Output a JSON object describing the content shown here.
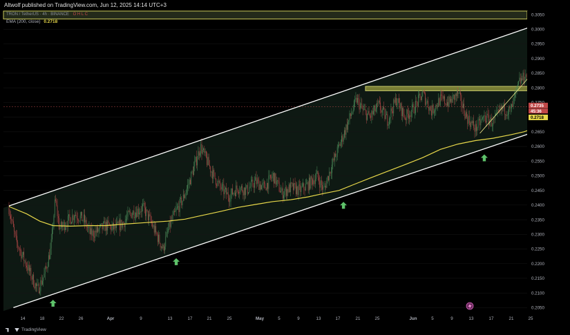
{
  "header": {
    "title": "Altwolf published on TradingView.com, Jun 12, 2025 14:14 UTC+3"
  },
  "legend": {
    "symbol": "TRON / TetherUS · 4h · BINANCE",
    "ohlc": "O  H  L  C",
    "ema_label": "EMA (200, close)",
    "ema_value": "0.2718"
  },
  "footer": {
    "brand": "TradingView"
  },
  "colors": {
    "background": "#000000",
    "up_candle": "#4d8c5a",
    "down_candle": "#b34747",
    "ema": "#e8d84a",
    "channel": "#ffffff",
    "resistance_box": "#c8c85a",
    "arrow": "#5ec26a"
  },
  "chart_data": {
    "type": "candlestick",
    "ylim": [
      0.2025,
      0.3062
    ],
    "y_ticks": [
      "0.3050",
      "0.3000",
      "0.2950",
      "0.2900",
      "0.2850",
      "0.2800",
      "0.2750",
      "0.2700",
      "0.2650",
      "0.2600",
      "0.2550",
      "0.2500",
      "0.2450",
      "0.2400",
      "0.2350",
      "0.2300",
      "0.2250",
      "0.2200",
      "0.2150",
      "0.2100",
      "0.2050"
    ],
    "x_ticks": [
      "14",
      "18",
      "22",
      "26",
      "Apr",
      "9",
      "13",
      "17",
      "21",
      "25",
      "May",
      "5",
      "9",
      "13",
      "17",
      "21",
      "25",
      "Jun",
      "5",
      "9",
      "13",
      "17",
      "21",
      "25"
    ],
    "price_label": "0.2735",
    "countdown_label": "45:36",
    "ema_price_label": "0.2718",
    "ema_path": [
      [
        0,
        0.2395
      ],
      [
        4,
        0.237
      ],
      [
        7,
        0.2345
      ],
      [
        10,
        0.233
      ],
      [
        14,
        0.2328
      ],
      [
        18,
        0.233
      ],
      [
        22,
        0.233
      ],
      [
        26,
        0.2335
      ],
      [
        31,
        0.234
      ],
      [
        36,
        0.2345
      ],
      [
        40,
        0.2352
      ],
      [
        44,
        0.2365
      ],
      [
        48,
        0.2378
      ],
      [
        52,
        0.2392
      ],
      [
        56,
        0.2402
      ],
      [
        60,
        0.2412
      ],
      [
        64,
        0.2418
      ],
      [
        68,
        0.2428
      ],
      [
        71,
        0.2438
      ],
      [
        75,
        0.245
      ],
      [
        78,
        0.2468
      ],
      [
        82,
        0.2492
      ],
      [
        86,
        0.2515
      ],
      [
        90,
        0.2538
      ],
      [
        94,
        0.2562
      ],
      [
        98,
        0.259
      ],
      [
        102,
        0.2608
      ],
      [
        106,
        0.262
      ],
      [
        110,
        0.2628
      ],
      [
        114,
        0.264
      ],
      [
        117,
        0.265
      ],
      [
        120,
        0.2665
      ],
      [
        123,
        0.269
      ],
      [
        126,
        0.2718
      ]
    ],
    "price_path": [
      [
        0,
        0.239
      ],
      [
        1.5,
        0.228
      ],
      [
        3,
        0.223
      ],
      [
        5,
        0.216
      ],
      [
        6.5,
        0.211
      ],
      [
        8,
        0.216
      ],
      [
        9.5,
        0.225
      ],
      [
        10.5,
        0.242
      ],
      [
        11.5,
        0.232
      ],
      [
        13,
        0.234
      ],
      [
        15,
        0.237
      ],
      [
        17,
        0.235
      ],
      [
        18.5,
        0.23
      ],
      [
        20,
        0.231
      ],
      [
        22,
        0.233
      ],
      [
        24,
        0.232
      ],
      [
        26,
        0.234
      ],
      [
        27.5,
        0.237
      ],
      [
        29,
        0.238
      ],
      [
        30.5,
        0.239
      ],
      [
        32,
        0.235
      ],
      [
        33.5,
        0.23
      ],
      [
        35,
        0.225
      ],
      [
        36.5,
        0.233
      ],
      [
        38,
        0.238
      ],
      [
        39.5,
        0.242
      ],
      [
        41,
        0.248
      ],
      [
        42.5,
        0.255
      ],
      [
        43.5,
        0.26
      ],
      [
        45,
        0.255
      ],
      [
        46.5,
        0.25
      ],
      [
        48,
        0.246
      ],
      [
        50,
        0.243
      ],
      [
        52,
        0.246
      ],
      [
        54,
        0.245
      ],
      [
        56,
        0.248
      ],
      [
        58,
        0.246
      ],
      [
        60,
        0.25
      ],
      [
        62,
        0.244
      ],
      [
        64,
        0.246
      ],
      [
        66,
        0.245
      ],
      [
        68,
        0.247
      ],
      [
        70,
        0.25
      ],
      [
        71.5,
        0.245
      ],
      [
        73,
        0.252
      ],
      [
        75,
        0.26
      ],
      [
        77,
        0.268
      ],
      [
        79,
        0.276
      ],
      [
        80.5,
        0.272
      ],
      [
        82,
        0.27
      ],
      [
        84,
        0.274
      ],
      [
        86,
        0.269
      ],
      [
        88,
        0.276
      ],
      [
        90,
        0.27
      ],
      [
        92,
        0.273
      ],
      [
        94,
        0.278
      ],
      [
        96,
        0.272
      ],
      [
        98,
        0.276
      ],
      [
        100,
        0.275
      ],
      [
        102,
        0.278
      ],
      [
        104,
        0.27
      ],
      [
        106,
        0.266
      ],
      [
        108,
        0.27
      ],
      [
        110,
        0.268
      ],
      [
        112,
        0.273
      ],
      [
        114,
        0.272
      ],
      [
        116,
        0.282
      ],
      [
        118,
        0.285
      ],
      [
        119.5,
        0.293
      ],
      [
        121,
        0.288
      ],
      [
        122.5,
        0.28
      ],
      [
        124,
        0.276
      ],
      [
        125,
        0.2735
      ]
    ],
    "overlays": {
      "upper_channel": [
        [
          0,
          0.2397
        ],
        [
          130,
          0.3067
        ]
      ],
      "lower_channel": [
        [
          1,
          0.205
        ],
        [
          155,
          0.283
        ]
      ],
      "resistance_box": {
        "x": [
          81,
          125
        ],
        "y": [
          0.279,
          0.2805
        ]
      },
      "top_zone": {
        "y": [
          0.3035,
          0.3062
        ]
      },
      "trend_line": [
        [
          107,
          0.2645
        ],
        [
          124.5,
          0.2945
        ]
      ],
      "arrows_x": [
        10,
        38,
        76,
        108,
        127
      ]
    }
  }
}
